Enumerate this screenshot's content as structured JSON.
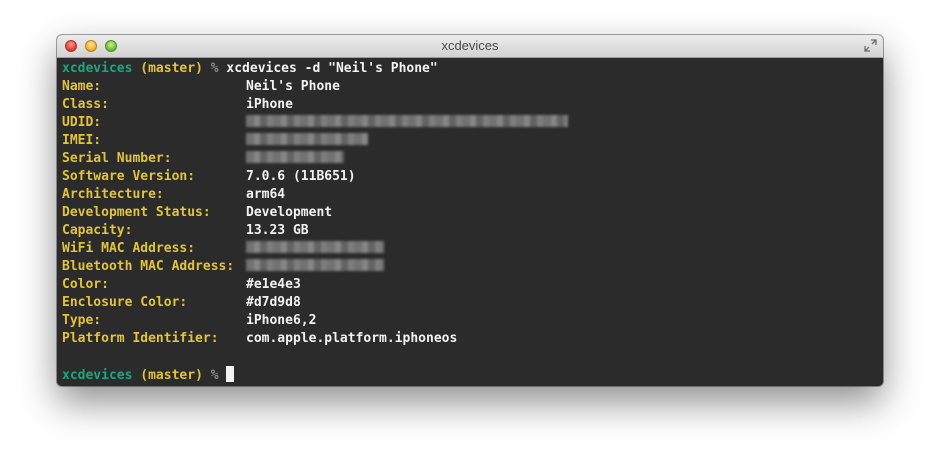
{
  "window": {
    "title": "xcdevices"
  },
  "prompt": {
    "dir": "xcdevices",
    "branch": "(master)",
    "symbol": "%"
  },
  "command": "xcdevices -d \"Neil's Phone\"",
  "rows": [
    {
      "label": "Name:",
      "value": "Neil's Phone",
      "redacted": false
    },
    {
      "label": "Class:",
      "value": "iPhone",
      "redacted": false
    },
    {
      "label": "UDID:",
      "value": "",
      "redacted": true
    },
    {
      "label": "IMEI:",
      "value": "",
      "redacted": true
    },
    {
      "label": "Serial Number:",
      "value": "",
      "redacted": true
    },
    {
      "label": "Software Version:",
      "value": "7.0.6 (11B651)",
      "redacted": false
    },
    {
      "label": "Architecture:",
      "value": "arm64",
      "redacted": false
    },
    {
      "label": "Development Status:",
      "value": "Development",
      "redacted": false
    },
    {
      "label": "Capacity:",
      "value": "13.23 GB",
      "redacted": false
    },
    {
      "label": "WiFi MAC Address:",
      "value": "",
      "redacted": true
    },
    {
      "label": "Bluetooth MAC Address:",
      "value": "",
      "redacted": true
    },
    {
      "label": "Color:",
      "value": "#e1e4e3",
      "redacted": false
    },
    {
      "label": "Enclosure Color:",
      "value": "#d7d9d8",
      "redacted": false
    },
    {
      "label": "Type:",
      "value": "iPhone6,2",
      "redacted": false
    },
    {
      "label": "Platform Identifier:",
      "value": "com.apple.platform.iphoneos",
      "redacted": false
    }
  ],
  "colors": {
    "prompt_dir": "#1ea67e",
    "prompt_branch": "#e2c43c",
    "labels": "#e2c43c",
    "values": "#f2f2f2",
    "background": "#2b2b2b"
  }
}
